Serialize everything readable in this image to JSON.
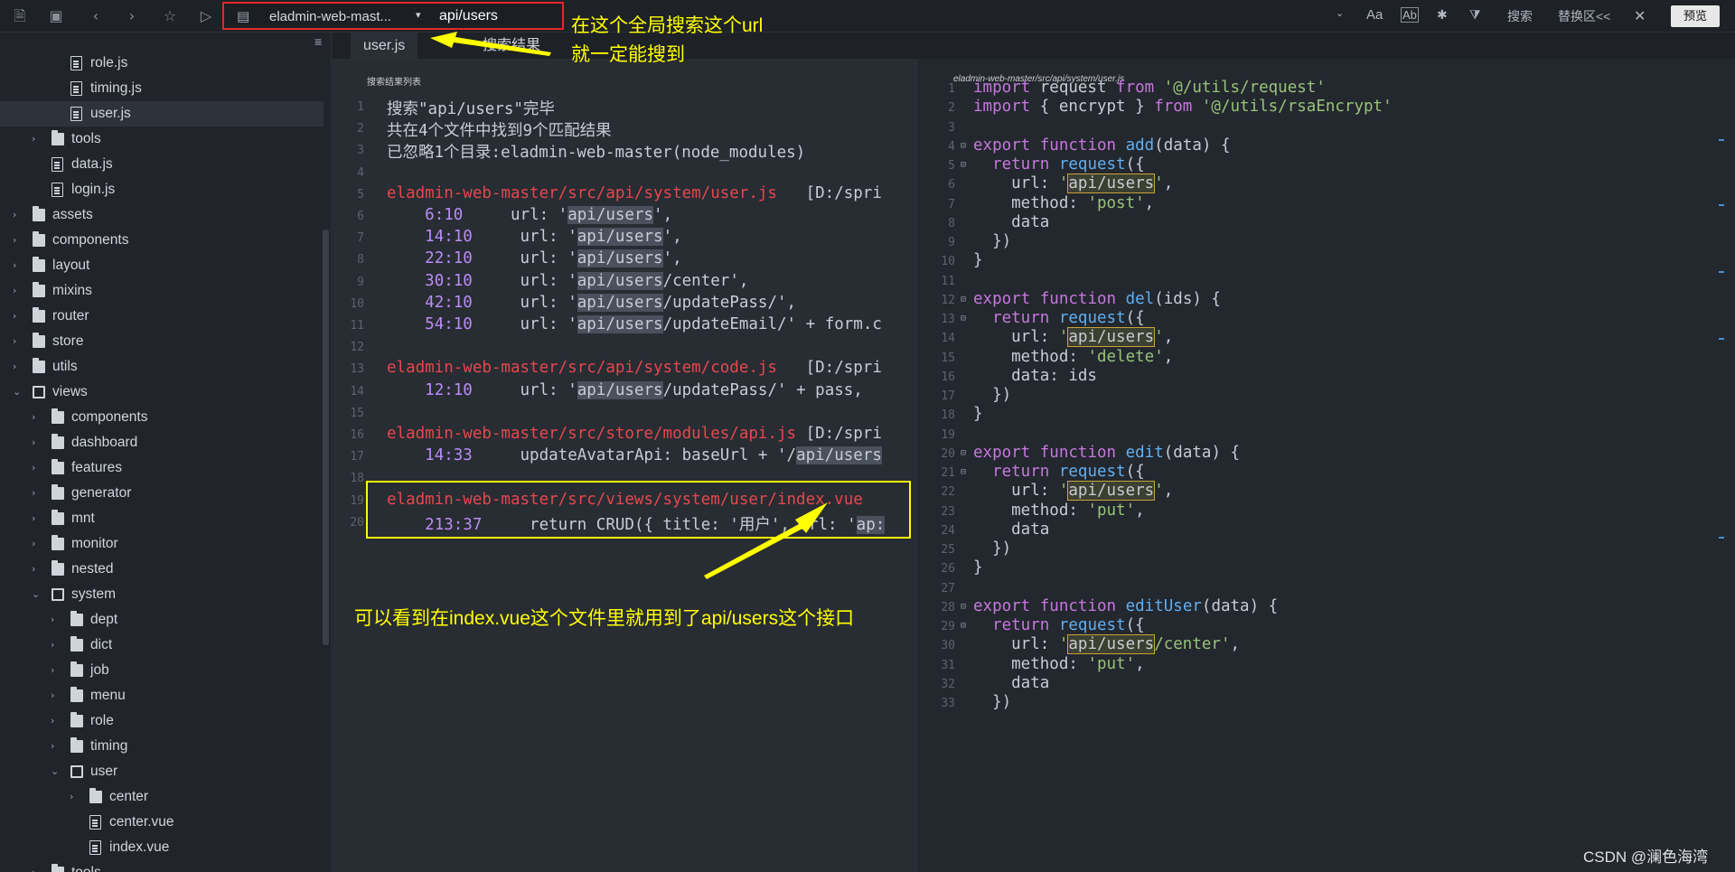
{
  "toolbar": {
    "search_scope": "eladmin-web-mast...",
    "search_query": "api/users",
    "search_label": "搜索",
    "replace_label": "替换区<<",
    "preview_label": "预览",
    "case_label": "Aa",
    "word_label": "Ab",
    "icons": [
      "file-icon",
      "save-icon",
      "back-icon",
      "forward-icon",
      "star-icon",
      "play-icon",
      "folder-icon",
      "chevron-down-icon",
      "regex-icon",
      "filter-icon",
      "close-icon"
    ]
  },
  "sidebar": {
    "items": [
      {
        "label": "role.js",
        "type": "file",
        "depth": 4
      },
      {
        "label": "timing.js",
        "type": "file",
        "depth": 4
      },
      {
        "label": "user.js",
        "type": "file",
        "depth": 4,
        "selected": true
      },
      {
        "label": "tools",
        "type": "folder",
        "depth": 3
      },
      {
        "label": "data.js",
        "type": "file",
        "depth": 3
      },
      {
        "label": "login.js",
        "type": "file",
        "depth": 3
      },
      {
        "label": "assets",
        "type": "folder",
        "depth": 2
      },
      {
        "label": "components",
        "type": "folder",
        "depth": 2
      },
      {
        "label": "layout",
        "type": "folder",
        "depth": 2
      },
      {
        "label": "mixins",
        "type": "folder",
        "depth": 2
      },
      {
        "label": "router",
        "type": "folder",
        "depth": 2
      },
      {
        "label": "store",
        "type": "folder",
        "depth": 2
      },
      {
        "label": "utils",
        "type": "folder",
        "depth": 2
      },
      {
        "label": "views",
        "type": "folder-open",
        "depth": 2
      },
      {
        "label": "components",
        "type": "folder",
        "depth": 3
      },
      {
        "label": "dashboard",
        "type": "folder",
        "depth": 3
      },
      {
        "label": "features",
        "type": "folder",
        "depth": 3
      },
      {
        "label": "generator",
        "type": "folder",
        "depth": 3
      },
      {
        "label": "mnt",
        "type": "folder",
        "depth": 3
      },
      {
        "label": "monitor",
        "type": "folder",
        "depth": 3
      },
      {
        "label": "nested",
        "type": "folder",
        "depth": 3
      },
      {
        "label": "system",
        "type": "folder-open",
        "depth": 3
      },
      {
        "label": "dept",
        "type": "folder",
        "depth": 4
      },
      {
        "label": "dict",
        "type": "folder",
        "depth": 4
      },
      {
        "label": "job",
        "type": "folder",
        "depth": 4
      },
      {
        "label": "menu",
        "type": "folder",
        "depth": 4
      },
      {
        "label": "role",
        "type": "folder",
        "depth": 4
      },
      {
        "label": "timing",
        "type": "folder",
        "depth": 4
      },
      {
        "label": "user",
        "type": "folder-open",
        "depth": 4
      },
      {
        "label": "center",
        "type": "folder",
        "depth": 5
      },
      {
        "label": "center.vue",
        "type": "vue",
        "depth": 5
      },
      {
        "label": "index.vue",
        "type": "vue",
        "depth": 5
      },
      {
        "label": "tools",
        "type": "folder",
        "depth": 3
      }
    ]
  },
  "tabs": [
    {
      "label": "user.js",
      "active": true
    },
    {
      "label": "搜索结果",
      "active": false
    }
  ],
  "results": {
    "title": "搜索结果列表",
    "lines": [
      {
        "n": "1",
        "text": "搜索\"api/users\"完毕"
      },
      {
        "n": "2",
        "text": "共在4个文件中找到9个匹配结果"
      },
      {
        "n": "3",
        "text": "已忽略1个目录:eladmin-web-master(node_modules)"
      },
      {
        "n": "4",
        "text": ""
      },
      {
        "n": "5",
        "path": "eladmin-web-master/src/api/system/user.js",
        "meta": "   [D:/spri"
      },
      {
        "n": "6",
        "loc": "6:10",
        "pre": "     url: '",
        "hl": "api/users",
        "post": "',"
      },
      {
        "n": "7",
        "loc": "14:10",
        "pre": "     url: '",
        "hl": "api/users",
        "post": "',"
      },
      {
        "n": "8",
        "loc": "22:10",
        "pre": "     url: '",
        "hl": "api/users",
        "post": "',"
      },
      {
        "n": "9",
        "loc": "30:10",
        "pre": "     url: '",
        "hl": "api/users",
        "post": "/center',"
      },
      {
        "n": "10",
        "loc": "42:10",
        "pre": "     url: '",
        "hl": "api/users",
        "post": "/updatePass/',"
      },
      {
        "n": "11",
        "loc": "54:10",
        "pre": "     url: '",
        "hl": "api/users",
        "post": "/updateEmail/' + form.c"
      },
      {
        "n": "12",
        "text": ""
      },
      {
        "n": "13",
        "path": "eladmin-web-master/src/api/system/code.js",
        "meta": "   [D:/spri"
      },
      {
        "n": "14",
        "loc": "12:10",
        "pre": "     url: '",
        "hl": "api/users",
        "post": "/updatePass/' + pass,"
      },
      {
        "n": "15",
        "text": ""
      },
      {
        "n": "16",
        "path": "eladmin-web-master/src/store/modules/api.js",
        "meta": " [D:/spri"
      },
      {
        "n": "17",
        "loc": "14:33",
        "pre": "     updateAvatarApi: baseUrl + '/",
        "hl": "api/users",
        "post": ""
      },
      {
        "n": "18",
        "text": ""
      },
      {
        "n": "19",
        "path": "eladmin-web-master/src/views/system/user/index.vue",
        "meta": ""
      },
      {
        "n": "20",
        "loc": "213:37",
        "pre": "     return CRUD({ title: '用户', url: '",
        "hl": "ap:",
        "post": ""
      }
    ]
  },
  "code": {
    "title": "eladmin-web-master/src/api/system/user.js",
    "lines": [
      {
        "n": "1",
        "html": [
          [
            "kw",
            "import"
          ],
          [
            "",
            " request "
          ],
          [
            "kw",
            "from"
          ],
          [
            "",
            " "
          ],
          [
            "str",
            "'@/utils/request'"
          ]
        ]
      },
      {
        "n": "2",
        "html": [
          [
            "kw",
            "import"
          ],
          [
            "",
            " { encrypt } "
          ],
          [
            "kw",
            "from"
          ],
          [
            "",
            " "
          ],
          [
            "str",
            "'@/utils/rsaEncrypt'"
          ]
        ]
      },
      {
        "n": "3",
        "html": []
      },
      {
        "n": "4",
        "fold": true,
        "html": [
          [
            "kw",
            "export"
          ],
          [
            "",
            " "
          ],
          [
            "kw",
            "function"
          ],
          [
            "",
            " "
          ],
          [
            "fn",
            "add"
          ],
          [
            "",
            "(data) {"
          ]
        ]
      },
      {
        "n": "5",
        "fold": true,
        "html": [
          [
            "",
            "  "
          ],
          [
            "kw",
            "return"
          ],
          [
            "",
            " "
          ],
          [
            "fn",
            "request"
          ],
          [
            "",
            "({"
          ]
        ]
      },
      {
        "n": "6",
        "html": [
          [
            "",
            "    url: "
          ],
          [
            "str",
            "'"
          ],
          [
            "hlbox",
            "api/users"
          ],
          [
            "str",
            "'"
          ],
          [
            "",
            ","
          ]
        ]
      },
      {
        "n": "7",
        "html": [
          [
            "",
            "    method: "
          ],
          [
            "str",
            "'post'"
          ],
          [
            "",
            ","
          ]
        ]
      },
      {
        "n": "8",
        "html": [
          [
            "",
            "    data"
          ]
        ]
      },
      {
        "n": "9",
        "html": [
          [
            "",
            "  })"
          ]
        ]
      },
      {
        "n": "10",
        "html": [
          [
            "",
            "}"
          ]
        ]
      },
      {
        "n": "11",
        "html": []
      },
      {
        "n": "12",
        "fold": true,
        "html": [
          [
            "kw",
            "export"
          ],
          [
            "",
            " "
          ],
          [
            "kw",
            "function"
          ],
          [
            "",
            " "
          ],
          [
            "fn",
            "del"
          ],
          [
            "",
            "(ids) {"
          ]
        ]
      },
      {
        "n": "13",
        "fold": true,
        "html": [
          [
            "",
            "  "
          ],
          [
            "kw",
            "return"
          ],
          [
            "",
            " "
          ],
          [
            "fn",
            "request"
          ],
          [
            "",
            "({"
          ]
        ]
      },
      {
        "n": "14",
        "html": [
          [
            "",
            "    url: "
          ],
          [
            "str",
            "'"
          ],
          [
            "hlbox",
            "api/users"
          ],
          [
            "str",
            "'"
          ],
          [
            "",
            ","
          ]
        ]
      },
      {
        "n": "15",
        "html": [
          [
            "",
            "    method: "
          ],
          [
            "str",
            "'delete'"
          ],
          [
            "",
            ","
          ]
        ]
      },
      {
        "n": "16",
        "html": [
          [
            "",
            "    data: ids"
          ]
        ]
      },
      {
        "n": "17",
        "html": [
          [
            "",
            "  })"
          ]
        ]
      },
      {
        "n": "18",
        "html": [
          [
            "",
            "}"
          ]
        ]
      },
      {
        "n": "19",
        "html": []
      },
      {
        "n": "20",
        "fold": true,
        "html": [
          [
            "kw",
            "export"
          ],
          [
            "",
            " "
          ],
          [
            "kw",
            "function"
          ],
          [
            "",
            " "
          ],
          [
            "fn",
            "edit"
          ],
          [
            "",
            "(data) {"
          ]
        ]
      },
      {
        "n": "21",
        "fold": true,
        "html": [
          [
            "",
            "  "
          ],
          [
            "kw",
            "return"
          ],
          [
            "",
            " "
          ],
          [
            "fn",
            "request"
          ],
          [
            "",
            "({"
          ]
        ]
      },
      {
        "n": "22",
        "html": [
          [
            "",
            "    url: "
          ],
          [
            "str",
            "'"
          ],
          [
            "hlbox",
            "api/users"
          ],
          [
            "str",
            "'"
          ],
          [
            "",
            ","
          ]
        ]
      },
      {
        "n": "23",
        "html": [
          [
            "",
            "    method: "
          ],
          [
            "str",
            "'put'"
          ],
          [
            "",
            ","
          ]
        ]
      },
      {
        "n": "24",
        "html": [
          [
            "",
            "    data"
          ]
        ]
      },
      {
        "n": "25",
        "html": [
          [
            "",
            "  })"
          ]
        ]
      },
      {
        "n": "26",
        "html": [
          [
            "",
            "}"
          ]
        ]
      },
      {
        "n": "27",
        "html": []
      },
      {
        "n": "28",
        "fold": true,
        "html": [
          [
            "kw",
            "export"
          ],
          [
            "",
            " "
          ],
          [
            "kw",
            "function"
          ],
          [
            "",
            " "
          ],
          [
            "fn",
            "editUser"
          ],
          [
            "",
            "(data) {"
          ]
        ]
      },
      {
        "n": "29",
        "fold": true,
        "html": [
          [
            "",
            "  "
          ],
          [
            "kw",
            "return"
          ],
          [
            "",
            " "
          ],
          [
            "fn",
            "request"
          ],
          [
            "",
            "({"
          ]
        ]
      },
      {
        "n": "30",
        "html": [
          [
            "",
            "    url: "
          ],
          [
            "str",
            "'"
          ],
          [
            "hlbox",
            "api/users"
          ],
          [
            "str",
            "/center'"
          ],
          [
            "",
            ","
          ]
        ]
      },
      {
        "n": "31",
        "html": [
          [
            "",
            "    method: "
          ],
          [
            "str",
            "'put'"
          ],
          [
            "",
            ","
          ]
        ]
      },
      {
        "n": "32",
        "html": [
          [
            "",
            "    data"
          ]
        ]
      },
      {
        "n": "33",
        "html": [
          [
            "",
            "  })"
          ]
        ]
      }
    ]
  },
  "annotations": {
    "top_line1": "在这个全局搜索这个url",
    "top_line2": "就一定能搜到",
    "bottom": "可以看到在index.vue这个文件里就用到了api/users这个接口"
  },
  "watermark": "CSDN @澜色海湾"
}
